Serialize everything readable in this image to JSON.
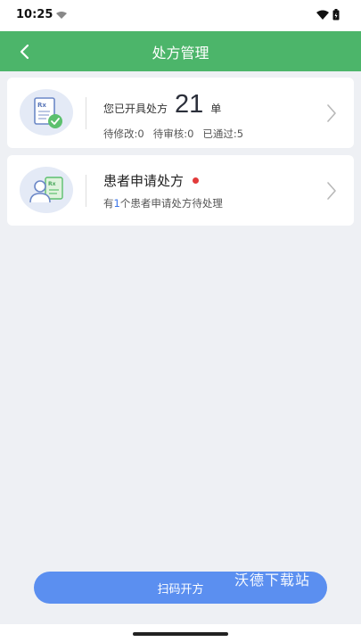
{
  "status_bar": {
    "time": "10:25"
  },
  "header": {
    "title": "处方管理"
  },
  "prescription_card": {
    "prefix": "您已开具处方",
    "count": "21",
    "unit": "单",
    "stats": [
      "待修改:0",
      "待审核:0",
      "已通过:5"
    ]
  },
  "patient_request_card": {
    "title": "患者申请处方",
    "sub_prefix": "有",
    "sub_count": "1",
    "sub_suffix": "个患者申请处方待处理"
  },
  "bottom": {
    "scan_button_label": "扫码开方",
    "watermark_text": "沃德下载站"
  },
  "colors": {
    "header_green": "#4cb56a",
    "button_blue": "#5b8ff0",
    "badge_red": "#e23b3b",
    "highlight_blue": "#3a74e8"
  }
}
